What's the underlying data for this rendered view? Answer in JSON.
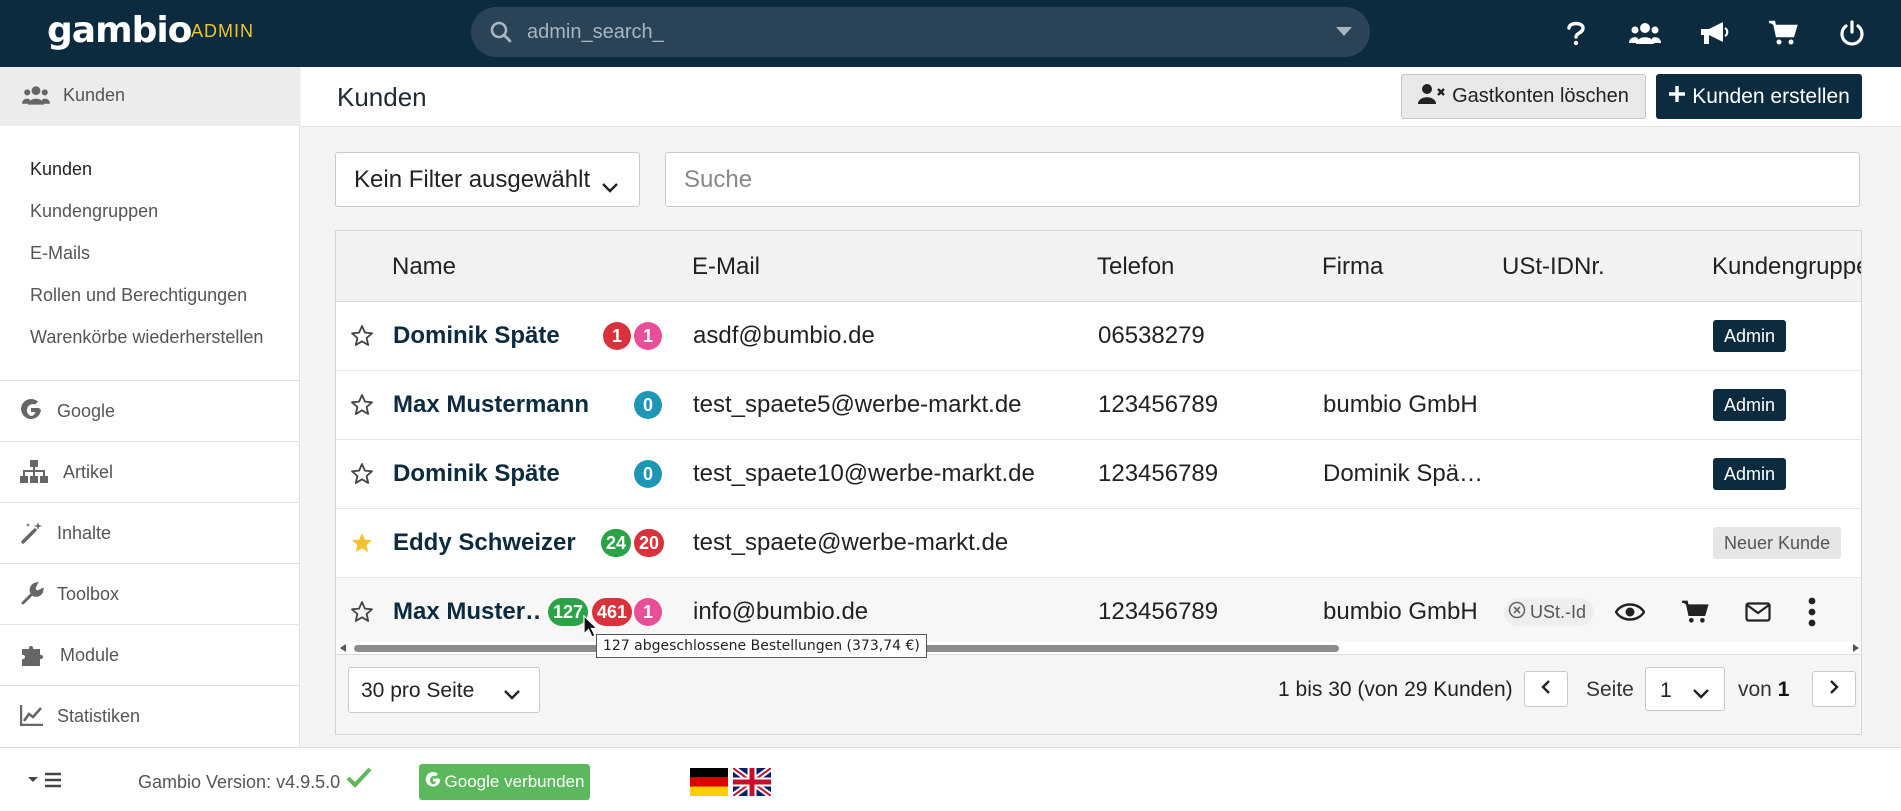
{
  "topbar": {
    "logo": "gambio",
    "admin_tag": "ADMIN",
    "search_placeholder": "admin_search_",
    "icons": [
      "help-icon",
      "users-icon",
      "megaphone-icon",
      "cart-icon",
      "power-icon"
    ]
  },
  "sidebar": {
    "section_title": "Kunden",
    "sublinks": [
      "Kunden",
      "Kundengruppen",
      "E-Mails",
      "Rollen und Berechtigungen",
      "Warenkörbe wiederherstellen"
    ],
    "items": [
      {
        "label": "Google",
        "icon": "google-icon"
      },
      {
        "label": "Artikel",
        "icon": "sitemap-icon"
      },
      {
        "label": "Inhalte",
        "icon": "magic-wand-icon"
      },
      {
        "label": "Toolbox",
        "icon": "wrench-icon"
      },
      {
        "label": "Module",
        "icon": "puzzle-icon"
      },
      {
        "label": "Statistiken",
        "icon": "chart-icon"
      }
    ]
  },
  "header": {
    "title": "Kunden",
    "btn_guest": "Gastkonten löschen",
    "btn_create": "Kunden erstellen"
  },
  "filters": {
    "filter_value": "Kein Filter ausgewählt",
    "search_placeholder": "Suche"
  },
  "table": {
    "columns": [
      "Name",
      "E-Mail",
      "Telefon",
      "Firma",
      "USt-IDNr.",
      "Kundengruppe"
    ],
    "rows": [
      {
        "name": "Dominik Späte",
        "starred": false,
        "badges": [
          {
            "v": "1",
            "c": "red"
          },
          {
            "v": "1",
            "c": "pink"
          }
        ],
        "email": "asdf@bumbio.de",
        "phone": "06538279",
        "company": "",
        "vat": "",
        "group": "Admin"
      },
      {
        "name": "Max Mustermann",
        "starred": false,
        "badges": [
          {
            "v": "0",
            "c": "teal"
          }
        ],
        "email": "test_spaete5@werbe-markt.de",
        "phone": "123456789",
        "company": "bumbio GmbH",
        "vat": "",
        "group": "Admin"
      },
      {
        "name": "Dominik Späte",
        "starred": false,
        "badges": [
          {
            "v": "0",
            "c": "teal"
          }
        ],
        "email": "test_spaete10@werbe-markt.de",
        "phone": "123456789",
        "company": "Dominik Spä…",
        "vat": "",
        "group": "Admin"
      },
      {
        "name": "Eddy Schweizer",
        "starred": true,
        "badges": [
          {
            "v": "24",
            "c": "green"
          },
          {
            "v": "20",
            "c": "red"
          }
        ],
        "email": "test_spaete@werbe-markt.de",
        "phone": "",
        "company": "",
        "vat": "",
        "group": "Neuer Kunde"
      },
      {
        "name": "Max Muster…",
        "starred": false,
        "badges": [
          {
            "v": "127",
            "c": "green"
          },
          {
            "v": "461",
            "c": "red"
          },
          {
            "v": "1",
            "c": "pink"
          }
        ],
        "email": "info@bumbio.de",
        "phone": "123456789",
        "company": "bumbio GmbH",
        "vat": "USt.-Id",
        "group": ""
      }
    ],
    "tooltip": "127 abgeschlossene Bestellungen (373,74 €)"
  },
  "pagination": {
    "per_page": "30 pro Seite",
    "info": "1 bis 30 (von 29 Kunden)",
    "page_label": "Seite",
    "page_value": "1",
    "of_label": "von",
    "total_pages": "1"
  },
  "footer": {
    "version": "Gambio Version: v4.9.5.0",
    "google_btn": "Google verbunden",
    "languages": [
      "de",
      "en"
    ]
  },
  "colors": {
    "brand": "#0c2b3e",
    "accent": "#f2c230",
    "green": "#28a346",
    "red": "#d9323d",
    "pink": "#e84f96",
    "teal": "#1e97b7"
  }
}
